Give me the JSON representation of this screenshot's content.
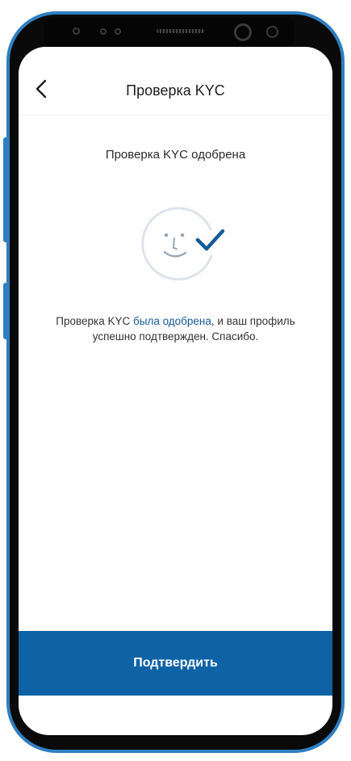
{
  "header": {
    "title": "Проверка KYC",
    "back_icon": "chevron-left-icon"
  },
  "status": {
    "title": "Проверка KYC одобрена"
  },
  "illustration": {
    "icon": "face-check-icon"
  },
  "message": {
    "part1": "Проверка KYC ",
    "highlight": "была одобрена",
    "part2": ", и ваш профиль успешно подтвержден. Спасибо."
  },
  "footer": {
    "confirm_label": "Подтвердить"
  },
  "colors": {
    "accent": "#0e63a6",
    "link": "#155a97",
    "frame": "#2f7fc0"
  }
}
